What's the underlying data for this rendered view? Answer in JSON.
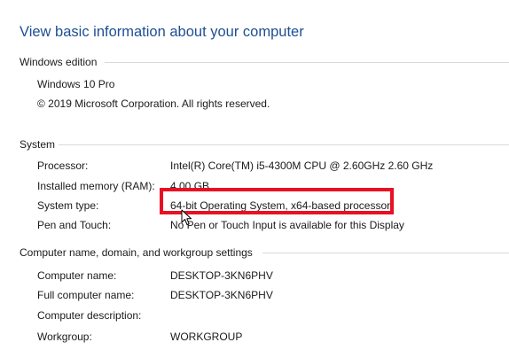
{
  "title": "View basic information about your computer",
  "windows_edition": {
    "heading": "Windows edition",
    "edition": "Windows 10 Pro",
    "copyright": "© 2019 Microsoft Corporation. All rights reserved."
  },
  "system": {
    "heading": "System",
    "processor_label": "Processor:",
    "processor_value": "Intel(R) Core(TM) i5-4300M CPU @ 2.60GHz   2.60 GHz",
    "memory_label": "Installed memory (RAM):",
    "memory_value": "4.00 GB",
    "type_label": "System type:",
    "type_value": "64-bit Operating System, x64-based processor",
    "pen_label": "Pen and Touch:",
    "pen_value": "No Pen or Touch Input is available for this Display"
  },
  "computer_name": {
    "heading": "Computer name, domain, and workgroup settings",
    "name_label": "Computer name:",
    "name_value": "DESKTOP-3KN6PHV",
    "full_label": "Full computer name:",
    "full_value": "DESKTOP-3KN6PHV",
    "desc_label": "Computer description:",
    "desc_value": "",
    "workgroup_label": "Workgroup:",
    "workgroup_value": "WORKGROUP"
  },
  "annotation": {
    "highlight_color": "#e81123",
    "accent_color": "#1e4f93"
  }
}
